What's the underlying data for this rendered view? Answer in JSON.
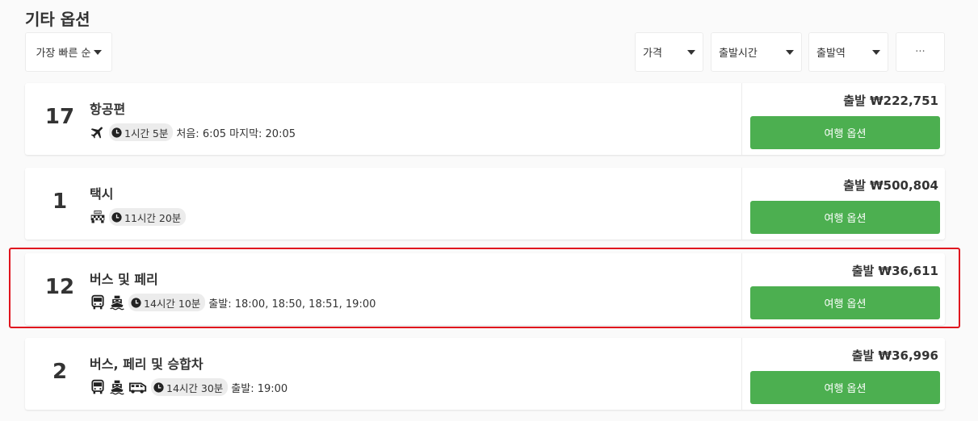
{
  "section_title": "기타 옵션",
  "sort": {
    "label": "가장 빠른 순"
  },
  "filters": [
    {
      "label": "가격"
    },
    {
      "label": "출발시간"
    },
    {
      "label": "출발역"
    }
  ],
  "more_label": "···",
  "options": [
    {
      "count": "17",
      "title": "항공편",
      "icons": [
        "airplane-icon"
      ],
      "duration": "1시간 5분",
      "details": "처음: 6:05 마지막: 20:05",
      "price": "출발 ₩222,751",
      "button": "여행 옵션"
    },
    {
      "count": "1",
      "title": "택시",
      "icons": [
        "taxi-icon"
      ],
      "duration": "11시간 20분",
      "details": "",
      "price": "출발 ₩500,804",
      "button": "여행 옵션"
    },
    {
      "count": "12",
      "title": "버스 및 페리",
      "icons": [
        "bus-icon",
        "ferry-icon"
      ],
      "duration": "14시간 10분",
      "details": "출발: 18:00, 18:50, 18:51, 19:00",
      "price": "출발 ₩36,611",
      "button": "여행 옵션",
      "highlighted": true
    },
    {
      "count": "2",
      "title": "버스, 페리 및 승합차",
      "icons": [
        "bus-icon",
        "ferry-icon",
        "van-icon"
      ],
      "duration": "14시간 30분",
      "details": "출발: 19:00",
      "price": "출발 ₩36,996",
      "button": "여행 옵션"
    }
  ],
  "colors": {
    "button_green": "#4caf50",
    "highlight_red": "#e0141e",
    "pill_gray": "#ececec"
  }
}
